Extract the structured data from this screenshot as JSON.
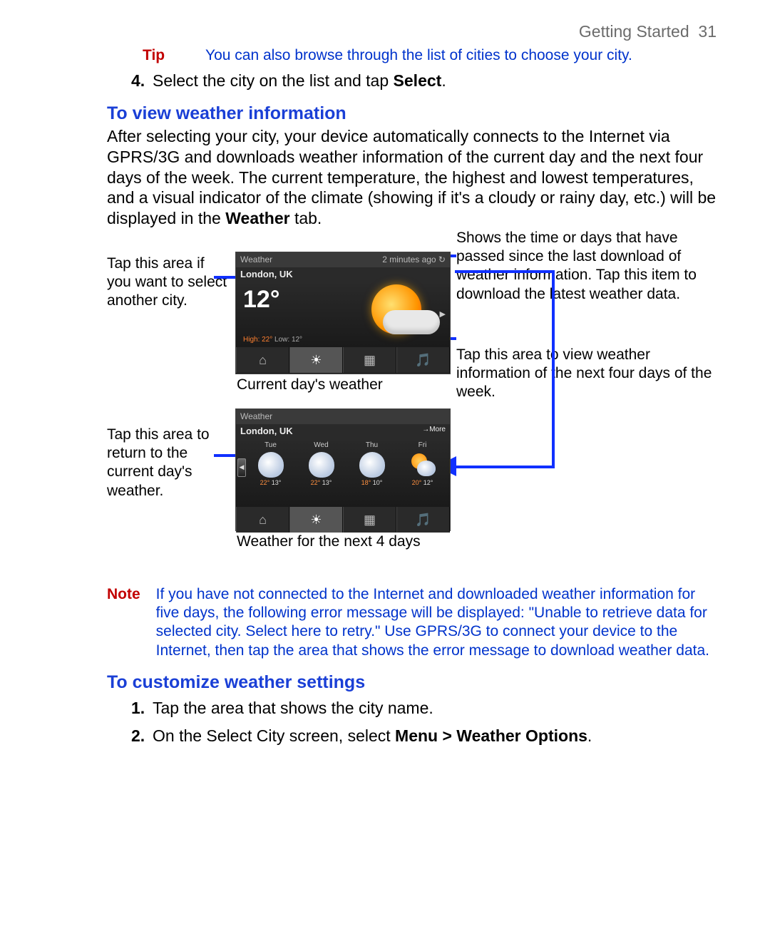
{
  "page": {
    "section": "Getting Started",
    "number": "31"
  },
  "tip": {
    "label": "Tip",
    "text": "You can also browse through the list of cities to choose your city."
  },
  "step4": {
    "num": "4.",
    "pre": "Select the city on the list and tap ",
    "bold": "Select",
    "post": "."
  },
  "h1": "To view weather information",
  "para1_pre": "After selecting your city, your device automatically connects to the Internet via GPRS/3G and downloads weather information of the current day and the next four days of the week. The current temperature, the highest and lowest temperatures, and a visual indicator of the climate (showing if it's a cloudy or rainy day, etc.) will be displayed in the ",
  "para1_bold": "Weather",
  "para1_post": " tab.",
  "callouts": {
    "left1": "Tap this area if you want to select another city.",
    "left2": "Tap this area to return to the current day's weather.",
    "right1": "Shows the time or days that have passed since the last download of weather information. Tap this item to download the latest weather data.",
    "right2": "Tap this area to view weather information of the next four days of the week."
  },
  "caption1": "Current day's weather",
  "caption2": "Weather for the next 4 days",
  "device1": {
    "title": "Weather",
    "status": "2 minutes ago ↻",
    "city": "London, UK",
    "temp": "12°",
    "hi_label": "High: ",
    "hi": "22°",
    "lo_label": "   Low: ",
    "lo": "12°"
  },
  "device2": {
    "title": "Weather",
    "city": "London, UK",
    "more": "→More",
    "days": [
      {
        "name": "Tue",
        "hi": "22°",
        "lo": "13°",
        "icon": "rain"
      },
      {
        "name": "Wed",
        "hi": "22°",
        "lo": "13°",
        "icon": "rain"
      },
      {
        "name": "Thu",
        "hi": "18°",
        "lo": "10°",
        "icon": "rain"
      },
      {
        "name": "Fri",
        "hi": "20°",
        "lo": "12°",
        "icon": "sunny"
      }
    ]
  },
  "tabs": {
    "home": "⌂",
    "weather": "☀",
    "apps": "▦",
    "music": "🎵"
  },
  "note": {
    "label": "Note",
    "text": "If you have not connected to the Internet and downloaded weather information for five days, the following error message will be displayed: \"Unable to retrieve data for selected city. Select here to retry.\" Use GPRS/3G to connect your device to the Internet, then tap the area that shows the error message to download weather data."
  },
  "h2": "To customize weather settings",
  "s1": {
    "num": "1.",
    "text": "Tap the area that shows the city name."
  },
  "s2": {
    "num": "2.",
    "pre": "On the Select City screen, select ",
    "bold": "Menu > Weather Options",
    "post": "."
  }
}
